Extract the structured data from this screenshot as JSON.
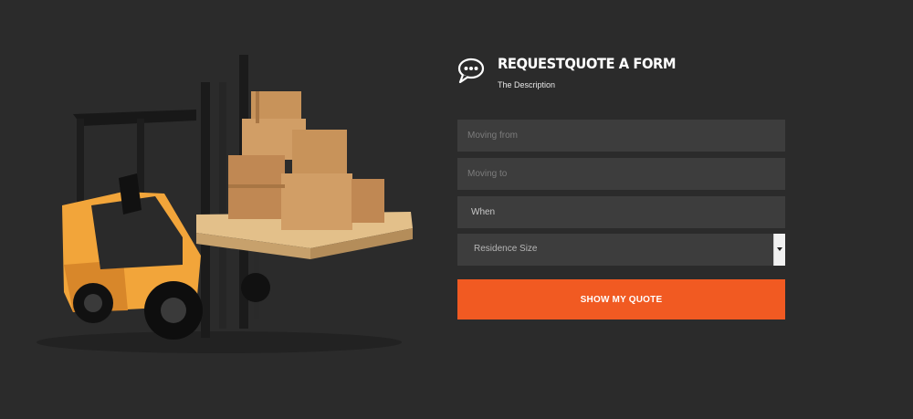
{
  "form": {
    "title": "REQUESTQUOTE A FORM",
    "description": "The Description",
    "fields": {
      "moving_from_placeholder": "Moving from",
      "moving_to_placeholder": "Moving to",
      "when_value": "When",
      "residence_size_selected": "Residence Size"
    },
    "submit_label": "SHOW MY QUOTE"
  },
  "icons": {
    "header": "speech-bubble-icon",
    "select": "chevron-down-icon"
  },
  "colors": {
    "background": "#2b2b2b",
    "field_bg": "#3d3d3d",
    "accent": "#f15a22",
    "forklift": "#f2a53a",
    "box": "#c8935a"
  }
}
